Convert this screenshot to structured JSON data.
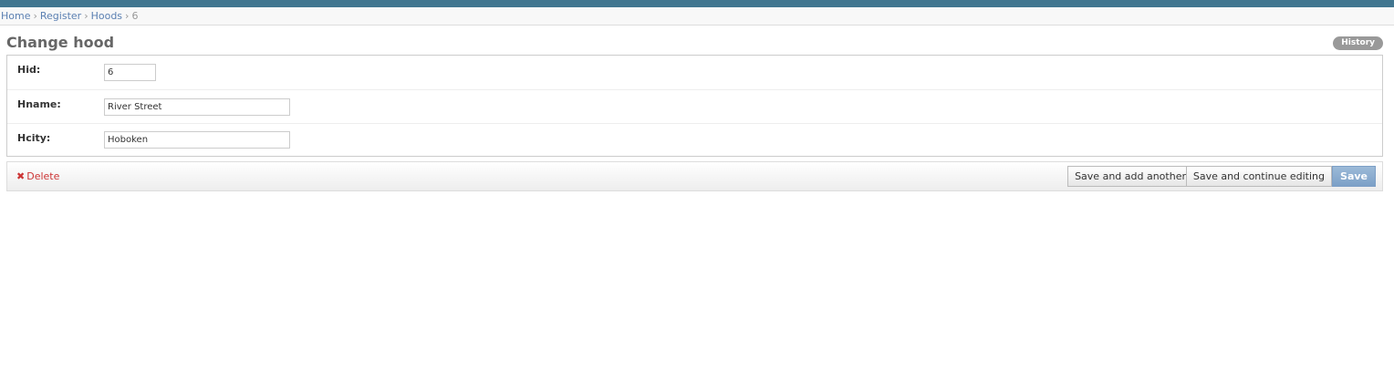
{
  "breadcrumbs": {
    "home": "Home",
    "register": "Register",
    "hoods": "Hoods",
    "current": "6",
    "separator": "›"
  },
  "page": {
    "title": "Change hood",
    "history_label": "History"
  },
  "form": {
    "hid": {
      "label": "Hid:",
      "value": "6"
    },
    "hname": {
      "label": "Hname:",
      "value": "River Street"
    },
    "hcity": {
      "label": "Hcity:",
      "value": "Hoboken"
    }
  },
  "submit": {
    "delete_icon": "✖",
    "delete_label": "Delete",
    "save_add_another": "Save and add another",
    "save_continue": "Save and continue editing",
    "save": "Save"
  },
  "colors": {
    "header_bar": "#417690",
    "link": "#5b80b2",
    "delete": "#cc3434",
    "save_button": "#7ca0c7"
  }
}
